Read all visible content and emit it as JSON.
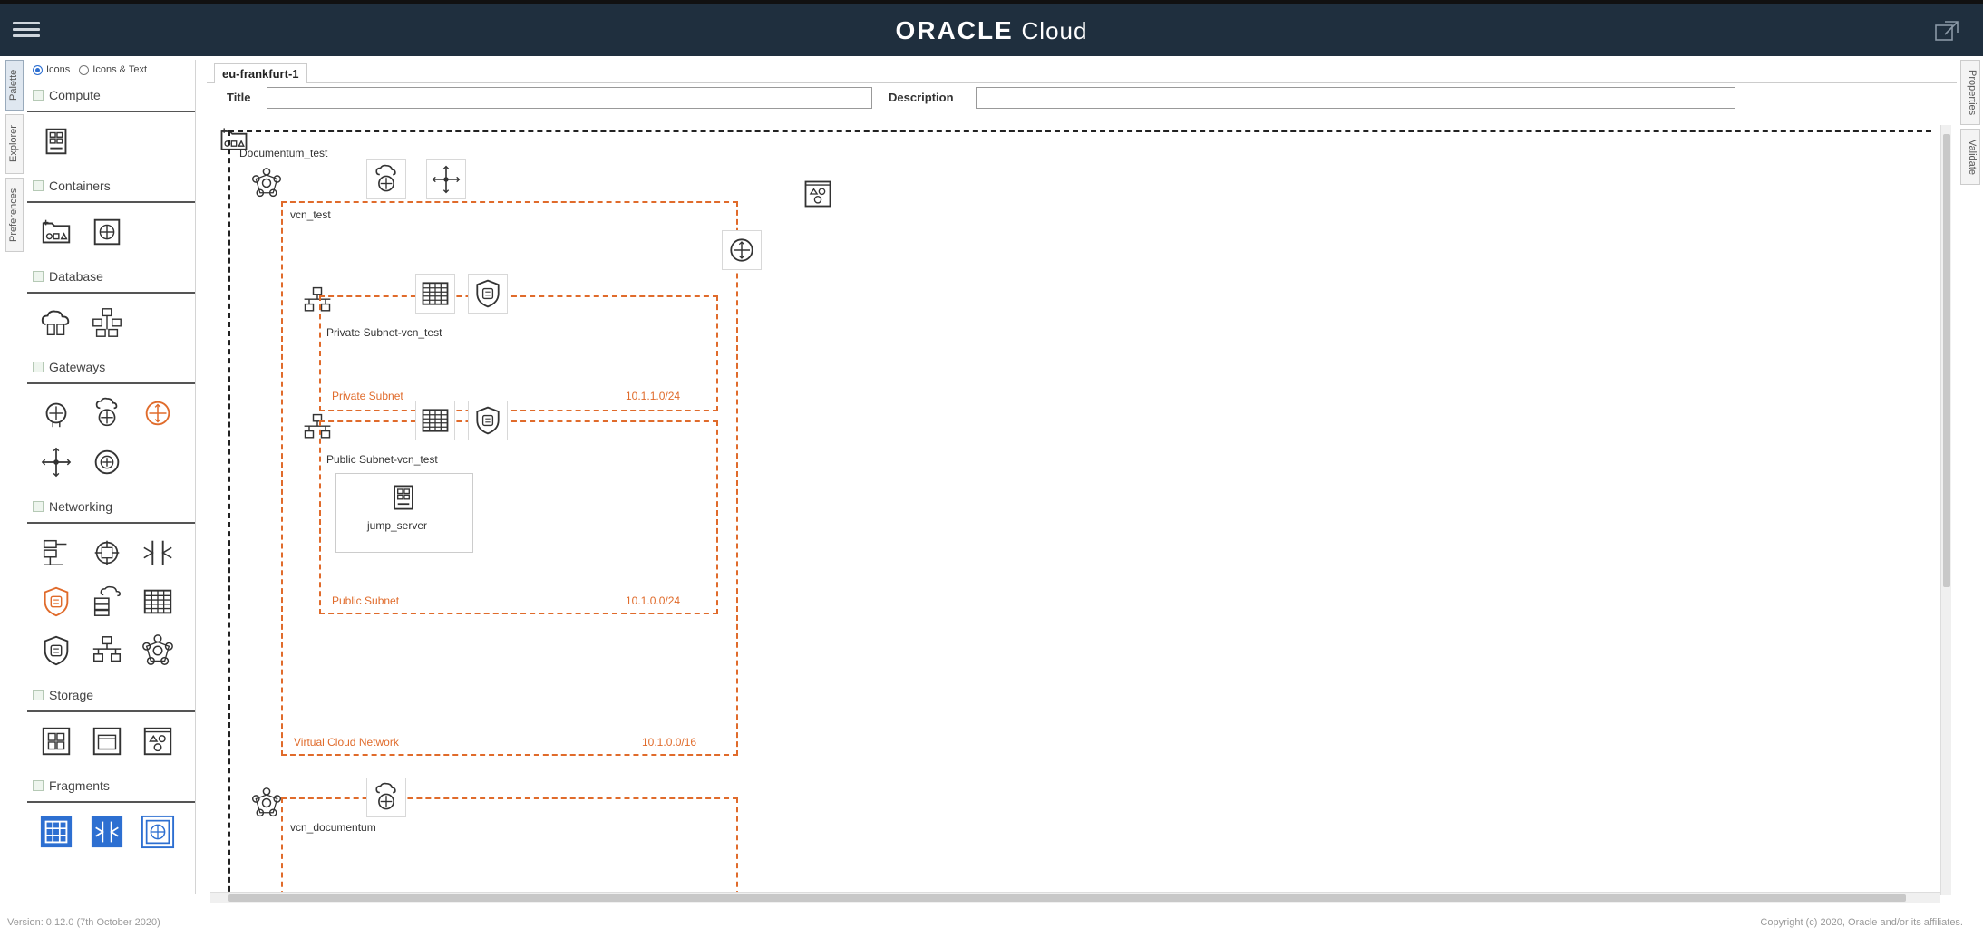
{
  "header": {
    "brand_bold": "ORACLE",
    "brand_light": "Cloud"
  },
  "left_tabs": [
    "Palette",
    "Explorer",
    "Preferences"
  ],
  "right_tabs": [
    "Properties",
    "Validate"
  ],
  "palette": {
    "view_options": [
      "Icons",
      "Icons & Text"
    ],
    "sections": {
      "compute": "Compute",
      "containers": "Containers",
      "database": "Database",
      "gateways": "Gateways",
      "networking": "Networking",
      "storage": "Storage",
      "fragments": "Fragments"
    }
  },
  "canvas": {
    "region_tab": "eu-frankfurt-1",
    "title_label": "Title",
    "title_value": "",
    "description_label": "Description",
    "description_value": "",
    "compartment_name": "Documentum_test",
    "vcn1": {
      "name": "vcn_test",
      "footer_label": "Virtual Cloud Network",
      "cidr": "10.1.0.0/16"
    },
    "private_subnet": {
      "name": "Private Subnet-vcn_test",
      "footer_label": "Private Subnet",
      "cidr": "10.1.1.0/24"
    },
    "public_subnet": {
      "name": "Public Subnet-vcn_test",
      "footer_label": "Public Subnet",
      "cidr": "10.1.0.0/24"
    },
    "instance": {
      "name": "jump_server"
    },
    "vcn2": {
      "name": "vcn_documentum"
    }
  },
  "colors": {
    "header_bg": "#1f2f3e",
    "accent_orange": "#e06b2b",
    "selected_blue": "#2d6fd1"
  },
  "footer": {
    "version": "Version: 0.12.0 (7th October 2020)",
    "copyright": "Copyright (c) 2020, Oracle and/or its affiliates."
  }
}
